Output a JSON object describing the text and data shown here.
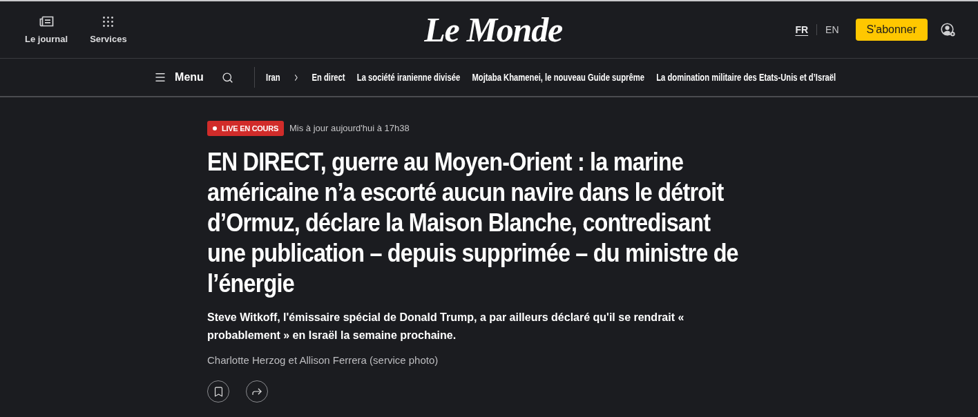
{
  "header": {
    "left_items": [
      {
        "kind": "journal",
        "label": "Le journal"
      },
      {
        "kind": "services",
        "label": "Services"
      }
    ],
    "logo": "Le Monde",
    "languages": [
      {
        "label": "FR",
        "selected": true
      },
      {
        "label": "EN",
        "selected": false
      }
    ],
    "subscribe_button": "S'abonner"
  },
  "nav": {
    "menu_label": "Menu",
    "topic": "Iran",
    "links": [
      "En direct",
      "La société iranienne divisée",
      "Mojtaba Khamenei, le nouveau Guide suprême",
      "La domination militaire des Etats-Unis et d’Israël"
    ]
  },
  "article": {
    "live_badge": "LIVE EN COURS",
    "updated": "Mis à jour aujourd'hui à 17h38",
    "headline": "EN DIRECT, guerre au Moyen-Orient : la marine américaine n’a escorté aucun navire dans le détroit d’Ormuz, déclare la Maison Blanche, contredisant une publication – depuis supprimée – du ministre de l’énergie",
    "standfirst": "Steve Witkoff, l'émissaire spécial de Donald Trump, a par ailleurs déclaré qu'il se rendrait « probablement » en Israël la semaine prochaine.",
    "byline": "Charlotte Herzog et Allison Ferrera (service photo)",
    "actions": [
      {
        "kind": "bookmark"
      },
      {
        "kind": "share"
      }
    ]
  }
}
